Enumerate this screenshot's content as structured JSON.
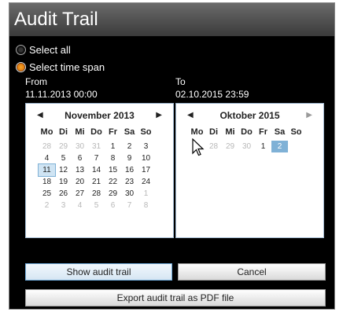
{
  "window": {
    "title": "Audit Trail"
  },
  "options": [
    {
      "label": "Select all",
      "checked": false
    },
    {
      "label": "Select time span",
      "checked": true
    }
  ],
  "from": {
    "label": "From",
    "value": "11.11.2013 00:00"
  },
  "to": {
    "label": "To",
    "value": "02.10.2015 23:59"
  },
  "weekdays": [
    "Mo",
    "Di",
    "Mi",
    "Do",
    "Fr",
    "Sa",
    "So"
  ],
  "cal_left": {
    "month": "November 2013",
    "days": [
      [
        "28",
        "29",
        "30",
        "31",
        "1",
        "2",
        "3"
      ],
      [
        "4",
        "5",
        "6",
        "7",
        "8",
        "9",
        "10"
      ],
      [
        "11",
        "12",
        "13",
        "14",
        "15",
        "16",
        "17"
      ],
      [
        "18",
        "19",
        "20",
        "21",
        "22",
        "23",
        "24"
      ],
      [
        "25",
        "26",
        "27",
        "28",
        "29",
        "30",
        "1"
      ],
      [
        "2",
        "3",
        "4",
        "5",
        "6",
        "7",
        "8"
      ]
    ],
    "selected": "11"
  },
  "cal_right": {
    "month": "Oktober 2015",
    "days": [
      [
        "28",
        "29",
        "30",
        "1",
        "2"
      ]
    ],
    "selected": "2"
  },
  "buttons": {
    "show": "Show audit trail",
    "cancel": "Cancel",
    "export": "Export audit trail as PDF file"
  },
  "icons": {
    "prev": "chevron-left-icon",
    "next": "chevron-right-icon",
    "cursor": "mouse-cursor-icon"
  }
}
